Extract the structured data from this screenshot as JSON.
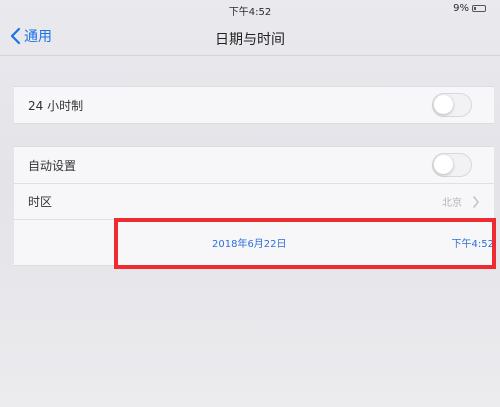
{
  "status_bar": {
    "time": "下午4:52",
    "battery": "9%"
  },
  "nav": {
    "back_label": "通用",
    "title": "日期与时间"
  },
  "settings": {
    "hour24": {
      "label": "24 小时制",
      "enabled": false
    },
    "auto_set": {
      "label": "自动设置",
      "enabled": false
    },
    "timezone": {
      "label": "时区",
      "value": "北京"
    },
    "date": "2018年6月22日",
    "time": "下午4:52"
  },
  "colors": {
    "accent": "#2f6fd8",
    "highlight": "#ee2a33"
  }
}
